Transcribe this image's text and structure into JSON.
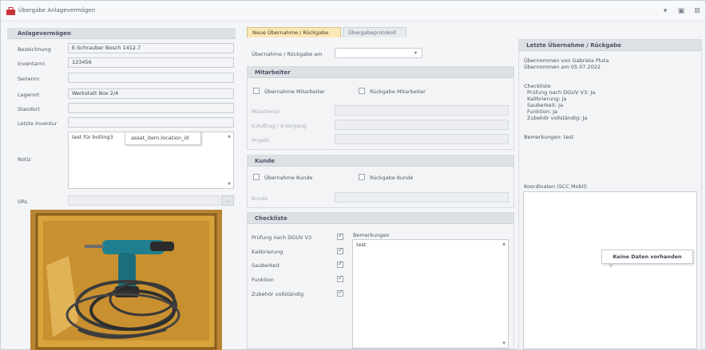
{
  "window": {
    "title": "Übergabe Anlagevermögen",
    "controls": [
      "minimize",
      "maximize",
      "close"
    ]
  },
  "left_panel": {
    "header": "Anlagevermögen",
    "fields": [
      {
        "label": "Bezeichnung",
        "value": "E-Schrauber Bosch 1412.7"
      },
      {
        "label": "Inventarnr.",
        "value": "123456"
      },
      {
        "label": "Seriennr.",
        "value": ""
      },
      {
        "label": "Lagerort",
        "value": "Werkstatt Box 2/4"
      },
      {
        "label": "Standort",
        "value": ""
      },
      {
        "label": "Letzte Inventur",
        "value": ""
      }
    ],
    "notiz_label": "Notiz",
    "notiz_value": "test für bolling3",
    "url_label": "URL",
    "url_value": "",
    "tooltip": "asset_item.location_id"
  },
  "tabs": [
    {
      "label": "Neue Übernahme / Rückgabe",
      "active": true
    },
    {
      "label": "Übergabeprotokoll",
      "active": false
    }
  ],
  "form": {
    "date_label": "Übernahme / Rückgabe am",
    "date_value": "",
    "mitarbeiter": {
      "header": "Mitarbeiter",
      "cb_uebernahme": "Übernahme Mitarbeiter",
      "cb_rueckgabe": "Rückgabe Mitarbeiter",
      "fields": [
        "Mitarbeiter",
        "K-Auftrag / K-Vorgang",
        "Projekt"
      ]
    },
    "kunde": {
      "header": "Kunde",
      "cb_uebernahme": "Übernahme Kunde",
      "cb_rueckgabe": "Rückgabe Kunde",
      "field": "Kunde"
    },
    "checkliste": {
      "header": "Checkliste",
      "items": [
        {
          "label": "Prüfung nach DGUV V3",
          "checked": true
        },
        {
          "label": "Kalibrierung",
          "checked": true
        },
        {
          "label": "Sauberkeit",
          "checked": true
        },
        {
          "label": "Funktion",
          "checked": true
        },
        {
          "label": "Zubehör vollständig",
          "checked": true
        }
      ],
      "bemerkungen_label": "Bemerkungen",
      "bemerkungen_value": "test"
    }
  },
  "right_panel": {
    "header": "Letzte Übernahme / Rückgabe",
    "uebernommen_von": "Übernommen von Gabriela Pluta",
    "uebernommen_am": "Übernommen am 05.07.2022",
    "checkliste_label": "Checkliste",
    "checkliste_lines": [
      "Prüfung nach DGUV V3: Ja",
      "Kalibrierung: Ja",
      "Sauberkeit: Ja",
      "Funktion: Ja",
      "Zubehör vollständig: Ja"
    ],
    "bemerkungen": "Bemerkungen: test",
    "koordinaten_label": "Koordinaten (SCC Mobil)",
    "keine_daten": "Keine Daten vorhanden"
  }
}
